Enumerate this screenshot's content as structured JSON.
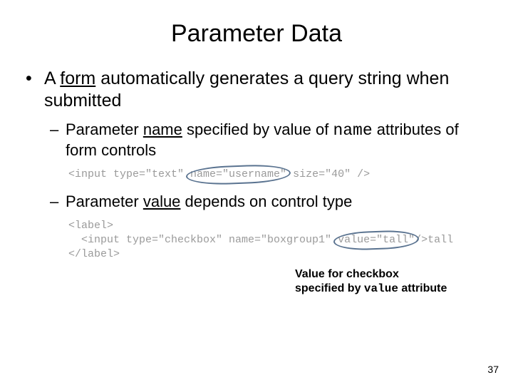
{
  "title": "Parameter Data",
  "bullet1": {
    "pre": "A ",
    "form_word": "form",
    "post": " automatically generates a query string when submitted"
  },
  "sub1": {
    "pre": "Parameter ",
    "underlined": "name",
    "mid": " specified by value of ",
    "code": "name",
    "post": " attributes of form controls"
  },
  "code1": {
    "pre": "<input type=\"text\" ",
    "hl": "name=\"username\"",
    "post": " size=\"40\" />"
  },
  "sub2": {
    "pre": "Parameter ",
    "underlined": "value",
    "post": " depends on control type"
  },
  "code2": {
    "line1": "<label>",
    "line2_pre": "  <input type=\"checkbox\" name=\"boxgroup1\" ",
    "line2_hl": "value=\"tall\"",
    "line2_post": "/>tall",
    "line3": "</label>"
  },
  "callout": {
    "line1": "Value for checkbox",
    "line2_pre": "specified by ",
    "line2_code": "value",
    "line2_post": " attribute"
  },
  "page_number": "37"
}
